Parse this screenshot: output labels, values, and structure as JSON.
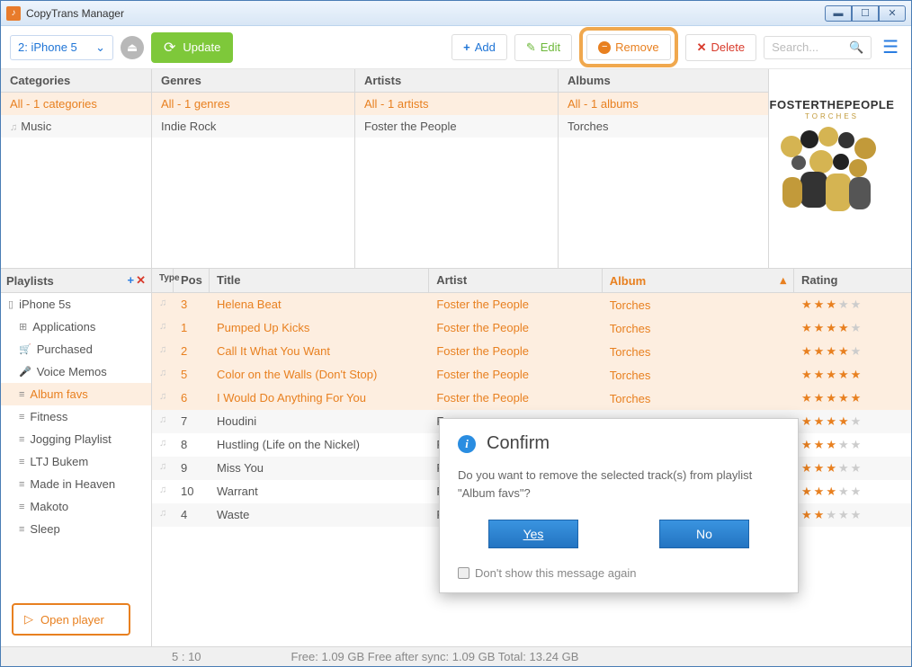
{
  "app": {
    "title": "CopyTrans Manager"
  },
  "toolbar": {
    "device": "2: iPhone 5",
    "update": "Update",
    "add": "Add",
    "edit": "Edit",
    "remove": "Remove",
    "delete": "Delete",
    "search_placeholder": "Search..."
  },
  "panels": {
    "categories": {
      "header": "Categories",
      "all": "All - 1 categories",
      "item": "Music"
    },
    "genres": {
      "header": "Genres",
      "all": "All - 1 genres",
      "item": "Indie Rock"
    },
    "artists": {
      "header": "Artists",
      "all": "All - 1 artists",
      "item": "Foster the People"
    },
    "albums": {
      "header": "Albums",
      "all": "All - 1 albums",
      "item": "Torches"
    }
  },
  "cover": {
    "line1": "FOSTERTHEPEOPLE",
    "line2": "TORCHES"
  },
  "playlists": {
    "header": "Playlists",
    "device": "iPhone 5s",
    "items": [
      {
        "label": "Applications",
        "icon": "apps"
      },
      {
        "label": "Purchased",
        "icon": "cart"
      },
      {
        "label": "Voice Memos",
        "icon": "mic"
      },
      {
        "label": "Album favs",
        "icon": "list",
        "selected": true
      },
      {
        "label": "Fitness",
        "icon": "list"
      },
      {
        "label": "Jogging Playlist",
        "icon": "list"
      },
      {
        "label": "LTJ Bukem",
        "icon": "list"
      },
      {
        "label": "Made in Heaven",
        "icon": "list"
      },
      {
        "label": "Makoto",
        "icon": "list"
      },
      {
        "label": "Sleep",
        "icon": "list"
      }
    ],
    "open_player": "Open player"
  },
  "tracks": {
    "headers": {
      "type": "Type",
      "pos": "Pos",
      "title": "Title",
      "artist": "Artist",
      "album": "Album",
      "rating": "Rating"
    },
    "rows": [
      {
        "pos": "3",
        "title": "Helena Beat",
        "artist": "Foster the People",
        "album": "Torches",
        "rating": 3,
        "sel": true
      },
      {
        "pos": "1",
        "title": "Pumped Up Kicks",
        "artist": "Foster the People",
        "album": "Torches",
        "rating": 4,
        "sel": true
      },
      {
        "pos": "2",
        "title": "Call It What You Want",
        "artist": "Foster the People",
        "album": "Torches",
        "rating": 4,
        "sel": true
      },
      {
        "pos": "5",
        "title": "Color on the Walls (Don't Stop)",
        "artist": "Foster the People",
        "album": "Torches",
        "rating": 5,
        "sel": true
      },
      {
        "pos": "6",
        "title": "I Would Do Anything For You",
        "artist": "Foster the People",
        "album": "Torches",
        "rating": 5,
        "sel": true
      },
      {
        "pos": "7",
        "title": "Houdini",
        "artist": "Fo",
        "album": "",
        "rating": 4,
        "sel": false
      },
      {
        "pos": "8",
        "title": "Hustling (Life on the Nickel)",
        "artist": "Fo",
        "album": "",
        "rating": 3,
        "sel": false
      },
      {
        "pos": "9",
        "title": "Miss You",
        "artist": "Fo",
        "album": "",
        "rating": 3,
        "sel": false
      },
      {
        "pos": "10",
        "title": "Warrant",
        "artist": "Fo",
        "album": "",
        "rating": 3,
        "sel": false
      },
      {
        "pos": "4",
        "title": "Waste",
        "artist": "Fo",
        "album": "",
        "rating": 2,
        "sel": false
      }
    ]
  },
  "status": {
    "count": "5 : 10",
    "space": "Free: 1.09 GB Free after sync: 1.09 GB Total: 13.24 GB"
  },
  "dialog": {
    "title": "Confirm",
    "body": "Do you want to remove the selected track(s) from playlist \"Album favs\"?",
    "yes": "Yes",
    "no": "No",
    "dont_show": "Don't show this message again"
  }
}
